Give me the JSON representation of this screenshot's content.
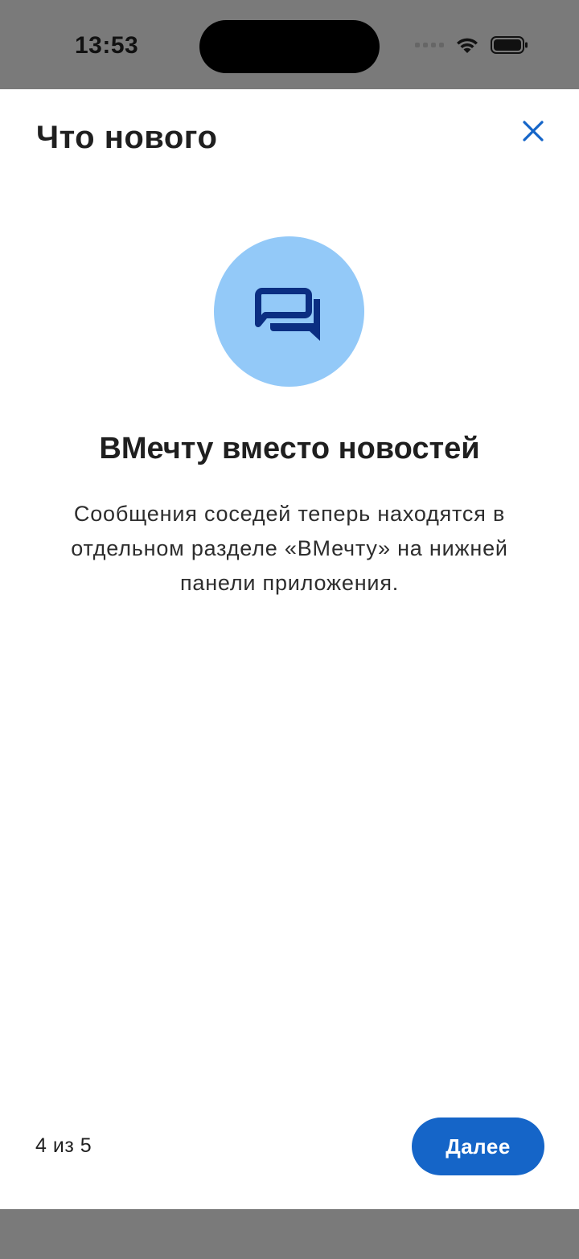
{
  "status_bar": {
    "time": "13:53"
  },
  "header": {
    "title": "Что нового"
  },
  "feature": {
    "icon": "chat-bubbles-icon",
    "title": "ВМечту вместо новостей",
    "description": "Сообщения соседей теперь находятся в отдельном разделе «ВМечту» на нижней панели приложения."
  },
  "footer": {
    "pager": "4 из 5",
    "next_label": "Далее"
  },
  "colors": {
    "accent": "#1565C8",
    "icon_circle": "#93C9F8",
    "icon_fill": "#0B2E82",
    "close_icon": "#1565C8"
  }
}
